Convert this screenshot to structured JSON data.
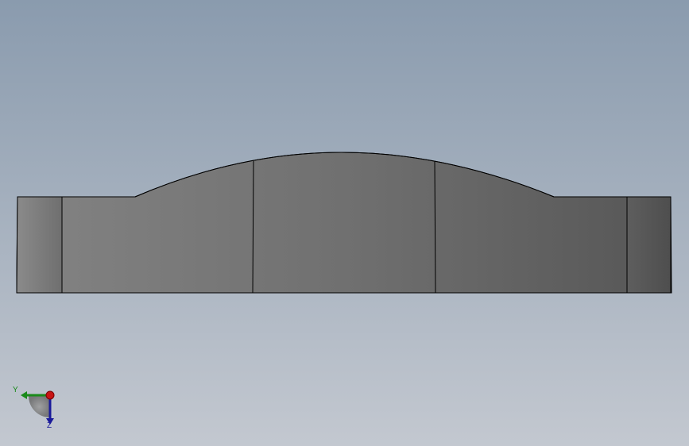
{
  "viewport": {
    "background_top": "#8a9bae",
    "background_bottom": "#c3c8d0"
  },
  "part": {
    "face_light": "#838383",
    "face_dark": "#565656",
    "edge_color": "#000000"
  },
  "triad": {
    "y_label": "Y",
    "z_label": "Z",
    "y_color": "#1a8a1a",
    "z_color": "#1a1a9a",
    "x_color": "#c81414",
    "icon": "coordinate-triad-icon"
  }
}
